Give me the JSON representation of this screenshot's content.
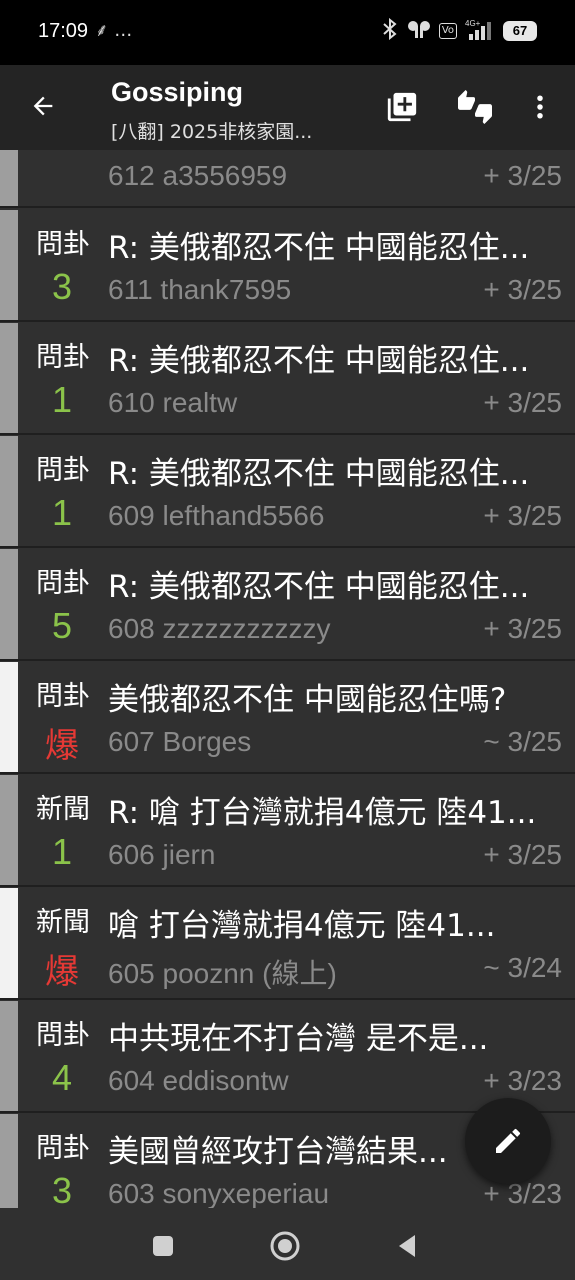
{
  "status_bar": {
    "time": "17:09",
    "left_icons": "⸙ …",
    "battery": "67"
  },
  "app_bar": {
    "title": "Gossiping",
    "subtitle": "[八翻] 2025非核家園..."
  },
  "posts": [
    {
      "category": "",
      "push": "",
      "hot": false,
      "unread": false,
      "title": "",
      "meta": "612 a3556959",
      "date": "+ 3/25"
    },
    {
      "category": "問卦",
      "push": "3",
      "hot": false,
      "unread": false,
      "title": "R: 美俄都忍不住 中國能忍住...",
      "meta": "611 thank7595",
      "date": "+ 3/25"
    },
    {
      "category": "問卦",
      "push": "1",
      "hot": false,
      "unread": false,
      "title": "R: 美俄都忍不住 中國能忍住...",
      "meta": "610 realtw",
      "date": "+ 3/25"
    },
    {
      "category": "問卦",
      "push": "1",
      "hot": false,
      "unread": false,
      "title": "R: 美俄都忍不住 中國能忍住...",
      "meta": "609 lefthand5566",
      "date": "+ 3/25"
    },
    {
      "category": "問卦",
      "push": "5",
      "hot": false,
      "unread": false,
      "title": "R: 美俄都忍不住 中國能忍住...",
      "meta": "608 zzzzzzzzzzzy",
      "date": "+ 3/25"
    },
    {
      "category": "問卦",
      "push": "爆",
      "hot": true,
      "unread": true,
      "title": "美俄都忍不住 中國能忍住嗎?",
      "meta": "607 Borges",
      "date": "~ 3/25"
    },
    {
      "category": "新聞",
      "push": "1",
      "hot": false,
      "unread": false,
      "title": "R: 嗆 打台灣就捐4億元  陸41...",
      "meta": "606 jiern",
      "date": "+ 3/25"
    },
    {
      "category": "新聞",
      "push": "爆",
      "hot": true,
      "unread": true,
      "title": "嗆 打台灣就捐4億元  陸41...",
      "meta": "605 pooznn (線上)",
      "date": "~ 3/24"
    },
    {
      "category": "問卦",
      "push": "4",
      "hot": false,
      "unread": false,
      "title": "中共現在不打台灣 是不是...",
      "meta": "604 eddisontw",
      "date": "+ 3/23"
    },
    {
      "category": "問卦",
      "push": "3",
      "hot": false,
      "unread": false,
      "title": "美國曾經攻打台灣結果...",
      "meta": "603 sonyxeperiau",
      "date": "+ 3/23"
    }
  ],
  "icons": {
    "back": "arrow-back-icon",
    "new_tab": "add-box-icon",
    "thumbs": "thumbs-up-down-icon",
    "more": "more-vert-icon",
    "compose": "edit-icon"
  },
  "colors": {
    "push_green": "#8bc34a",
    "hot_red": "#e53935"
  }
}
